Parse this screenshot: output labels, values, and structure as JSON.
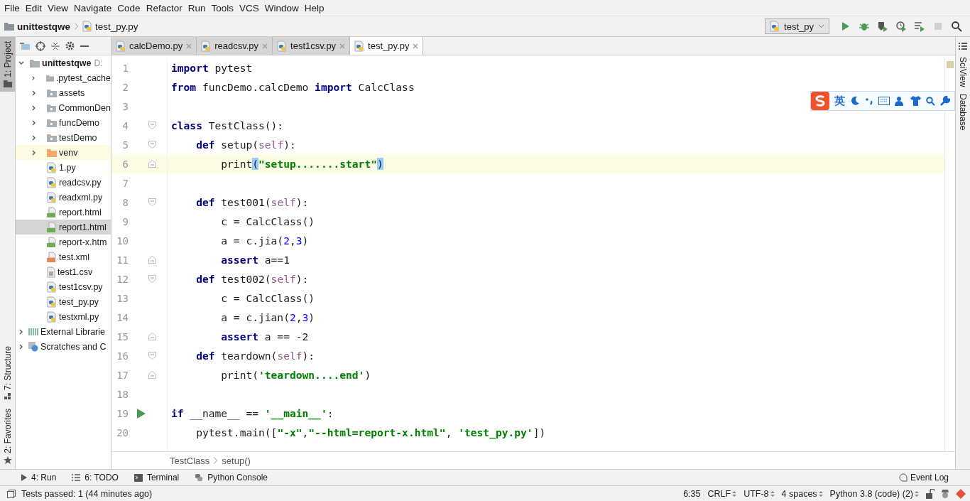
{
  "menu": [
    {
      "label": "File"
    },
    {
      "label": "Edit"
    },
    {
      "label": "View"
    },
    {
      "label": "Navigate"
    },
    {
      "label": "Code"
    },
    {
      "label": "Refactor"
    },
    {
      "label": "Run"
    },
    {
      "label": "Tools"
    },
    {
      "label": "VCS"
    },
    {
      "label": "Window"
    },
    {
      "label": "Help"
    }
  ],
  "breadcrumb": [
    {
      "label": "unittestqwe",
      "kind": "folder"
    },
    {
      "label": "test_py.py",
      "kind": "py"
    }
  ],
  "run_config": {
    "label": "test_py"
  },
  "toolbar": [
    {
      "kind": "run",
      "disabled": false
    },
    {
      "kind": "debug",
      "disabled": false
    },
    {
      "kind": "coverage",
      "disabled": false
    },
    {
      "kind": "profile",
      "disabled": false
    },
    {
      "kind": "concurrency",
      "disabled": false
    },
    {
      "kind": "stop",
      "disabled": true
    },
    {
      "kind": "search",
      "disabled": false
    }
  ],
  "left_strip": [
    {
      "label": "1: Project",
      "selected": true,
      "kind": "project"
    },
    {
      "label": "7: Structure",
      "selected": false,
      "kind": "structure"
    },
    {
      "label": "2: Favorites",
      "selected": false,
      "kind": "favorites"
    }
  ],
  "project": {
    "root": {
      "label": "unittestqwe",
      "path": "D:",
      "expanded": true,
      "children": [
        {
          "label": ".pytest_cache",
          "kind": "folder",
          "expandable": true,
          "selected": false,
          "highlighted": false
        },
        {
          "label": "assets",
          "kind": "package",
          "expandable": true,
          "selected": false,
          "highlighted": false
        },
        {
          "label": "CommonDen",
          "kind": "package",
          "expandable": true,
          "selected": false,
          "highlighted": false
        },
        {
          "label": "funcDemo",
          "kind": "package",
          "expandable": true,
          "selected": false,
          "highlighted": false
        },
        {
          "label": "testDemo",
          "kind": "package",
          "expandable": true,
          "selected": false,
          "highlighted": false
        },
        {
          "label": "venv",
          "kind": "excluded",
          "expandable": true,
          "selected": false,
          "highlighted": true
        },
        {
          "label": "1.py",
          "kind": "py",
          "expandable": false,
          "selected": false,
          "highlighted": false
        },
        {
          "label": "readcsv.py",
          "kind": "py",
          "expandable": false,
          "selected": false,
          "highlighted": false
        },
        {
          "label": "readxml.py",
          "kind": "py",
          "expandable": false,
          "selected": false,
          "highlighted": false
        },
        {
          "label": "report.html",
          "kind": "html",
          "expandable": false,
          "selected": false,
          "highlighted": false
        },
        {
          "label": "report1.html",
          "kind": "html",
          "expandable": false,
          "selected": true,
          "highlighted": false
        },
        {
          "label": "report-x.htm",
          "kind": "html",
          "expandable": false,
          "selected": false,
          "highlighted": false
        },
        {
          "label": "test.xml",
          "kind": "xml",
          "expandable": false,
          "selected": false,
          "highlighted": false
        },
        {
          "label": "test1.csv",
          "kind": "text",
          "expandable": false,
          "selected": false,
          "highlighted": false
        },
        {
          "label": "test1csv.py",
          "kind": "py",
          "expandable": false,
          "selected": false,
          "highlighted": false
        },
        {
          "label": "test_py.py",
          "kind": "py",
          "expandable": false,
          "selected": false,
          "highlighted": false
        },
        {
          "label": "testxml.py",
          "kind": "py",
          "expandable": false,
          "selected": false,
          "highlighted": false
        }
      ]
    },
    "others": [
      {
        "label": "External Librarie",
        "kind": "library"
      },
      {
        "label": "Scratches and C",
        "kind": "scratch"
      }
    ]
  },
  "tabs": [
    {
      "label": "calcDemo.py",
      "selected": false
    },
    {
      "label": "readcsv.py",
      "selected": false
    },
    {
      "label": "test1csv.py",
      "selected": false
    },
    {
      "label": "test_py.py",
      "selected": true
    }
  ],
  "code": [
    {
      "n": "1",
      "current": false,
      "run": false,
      "tokens": [
        {
          "text": "import",
          "kind": "kw"
        },
        {
          "text": " pytest",
          "kind": "plain"
        }
      ]
    },
    {
      "n": "2",
      "current": false,
      "run": false,
      "tokens": [
        {
          "text": "from",
          "kind": "kw"
        },
        {
          "text": " funcDemo.calcDemo ",
          "kind": "plain"
        },
        {
          "text": "import",
          "kind": "kw"
        },
        {
          "text": " CalcClass",
          "kind": "plain"
        }
      ]
    },
    {
      "n": "3",
      "current": false,
      "run": false
    },
    {
      "n": "4",
      "current": false,
      "run": false,
      "fold": {
        "kind": "start"
      },
      "tokens": [
        {
          "text": "class",
          "kind": "kw"
        },
        {
          "text": " TestClass():",
          "kind": "plain"
        }
      ]
    },
    {
      "n": "5",
      "current": false,
      "run": false,
      "fold": {
        "kind": "start"
      },
      "tokens": [
        {
          "text": "    def",
          "kind": "kw"
        },
        {
          "text": " setup(",
          "kind": "plain"
        },
        {
          "text": "self",
          "kind": "self"
        },
        {
          "text": "):",
          "kind": "plain"
        }
      ]
    },
    {
      "n": "6",
      "current": true,
      "run": false,
      "fold": {
        "kind": "end"
      },
      "tokens": [
        {
          "text": "        print",
          "kind": "plain"
        },
        {
          "text": "(",
          "kind": "brace"
        },
        {
          "text": "\"setup.......start\"",
          "kind": "str"
        },
        {
          "text": ")",
          "kind": "brace"
        }
      ]
    },
    {
      "n": "7",
      "current": false,
      "run": false
    },
    {
      "n": "8",
      "current": false,
      "run": false,
      "fold": {
        "kind": "start"
      },
      "tokens": [
        {
          "text": "    def",
          "kind": "kw"
        },
        {
          "text": " test001(",
          "kind": "plain"
        },
        {
          "text": "self",
          "kind": "self"
        },
        {
          "text": "):",
          "kind": "plain"
        }
      ]
    },
    {
      "n": "9",
      "current": false,
      "run": false,
      "tokens": [
        {
          "text": "        c = CalcClass()",
          "kind": "plain"
        }
      ]
    },
    {
      "n": "10",
      "current": false,
      "run": false,
      "tokens": [
        {
          "text": "        a = c.jia(",
          "kind": "plain"
        },
        {
          "text": "2",
          "kind": "num"
        },
        {
          "text": ",",
          "kind": "plain"
        },
        {
          "text": "3",
          "kind": "num"
        },
        {
          "text": ")",
          "kind": "plain"
        }
      ]
    },
    {
      "n": "11",
      "current": false,
      "run": false,
      "fold": {
        "kind": "end"
      },
      "tokens": [
        {
          "text": "        assert",
          "kind": "kw"
        },
        {
          "text": " a==1",
          "kind": "plain"
        }
      ]
    },
    {
      "n": "12",
      "current": false,
      "run": false,
      "fold": {
        "kind": "start"
      },
      "tokens": [
        {
          "text": "    def",
          "kind": "kw"
        },
        {
          "text": " test002(",
          "kind": "plain"
        },
        {
          "text": "self",
          "kind": "self"
        },
        {
          "text": "):",
          "kind": "plain"
        }
      ]
    },
    {
      "n": "13",
      "current": false,
      "run": false,
      "tokens": [
        {
          "text": "        c = CalcClass()",
          "kind": "plain"
        }
      ]
    },
    {
      "n": "14",
      "current": false,
      "run": false,
      "tokens": [
        {
          "text": "        a = c.jian(",
          "kind": "plain"
        },
        {
          "text": "2",
          "kind": "num"
        },
        {
          "text": ",",
          "kind": "plain"
        },
        {
          "text": "3",
          "kind": "num"
        },
        {
          "text": ")",
          "kind": "plain"
        }
      ]
    },
    {
      "n": "15",
      "current": false,
      "run": false,
      "fold": {
        "kind": "end"
      },
      "tokens": [
        {
          "text": "        assert",
          "kind": "kw"
        },
        {
          "text": " a == -2",
          "kind": "plain"
        }
      ]
    },
    {
      "n": "16",
      "current": false,
      "run": false,
      "fold": {
        "kind": "start"
      },
      "tokens": [
        {
          "text": "    def",
          "kind": "kw"
        },
        {
          "text": " teardown(",
          "kind": "plain"
        },
        {
          "text": "self",
          "kind": "self"
        },
        {
          "text": "):",
          "kind": "plain"
        }
      ]
    },
    {
      "n": "17",
      "current": false,
      "run": false,
      "fold": {
        "kind": "end"
      },
      "tokens": [
        {
          "text": "        print(",
          "kind": "plain"
        },
        {
          "text": "'teardown....end'",
          "kind": "str"
        },
        {
          "text": ")",
          "kind": "plain"
        }
      ]
    },
    {
      "n": "18",
      "current": false,
      "run": false
    },
    {
      "n": "19",
      "current": false,
      "run": true,
      "tokens": [
        {
          "text": "if",
          "kind": "kw"
        },
        {
          "text": " __name__ == ",
          "kind": "plain"
        },
        {
          "text": "'__main__'",
          "kind": "str"
        },
        {
          "text": ":",
          "kind": "plain"
        }
      ]
    },
    {
      "n": "20",
      "current": false,
      "run": false,
      "tokens": [
        {
          "text": "    pytest.main([",
          "kind": "plain"
        },
        {
          "text": "\"-x\"",
          "kind": "str"
        },
        {
          "text": ",",
          "kind": "plain"
        },
        {
          "text": "\"--html=report-x.html\"",
          "kind": "str"
        },
        {
          "text": ", ",
          "kind": "plain"
        },
        {
          "text": "'test_py.py'",
          "kind": "str"
        },
        {
          "text": "])",
          "kind": "plain"
        }
      ]
    }
  ],
  "editor_breadcrumb": [
    "TestClass",
    "setup()"
  ],
  "right_strip": [
    {
      "label": "SciView",
      "kind": "sciview"
    },
    {
      "label": "Database",
      "kind": "database"
    }
  ],
  "ime": {
    "mode": "英"
  },
  "tool_windows": [
    {
      "label": "4: Run",
      "kind": "run"
    },
    {
      "label": "6: TODO",
      "kind": "todo"
    },
    {
      "label": "Terminal",
      "kind": "terminal"
    },
    {
      "label": "Python Console",
      "kind": "console"
    }
  ],
  "event_log": "Event Log",
  "status": {
    "message": "Tests passed: 1 (44 minutes ago)",
    "items": [
      {
        "label": "6:35",
        "dropdown": false
      },
      {
        "label": "CRLF",
        "dropdown": true
      },
      {
        "label": "UTF-8",
        "dropdown": true
      },
      {
        "label": "4 spaces",
        "dropdown": true
      },
      {
        "label": "Python 3.8 (code) (2)",
        "dropdown": true
      }
    ]
  }
}
